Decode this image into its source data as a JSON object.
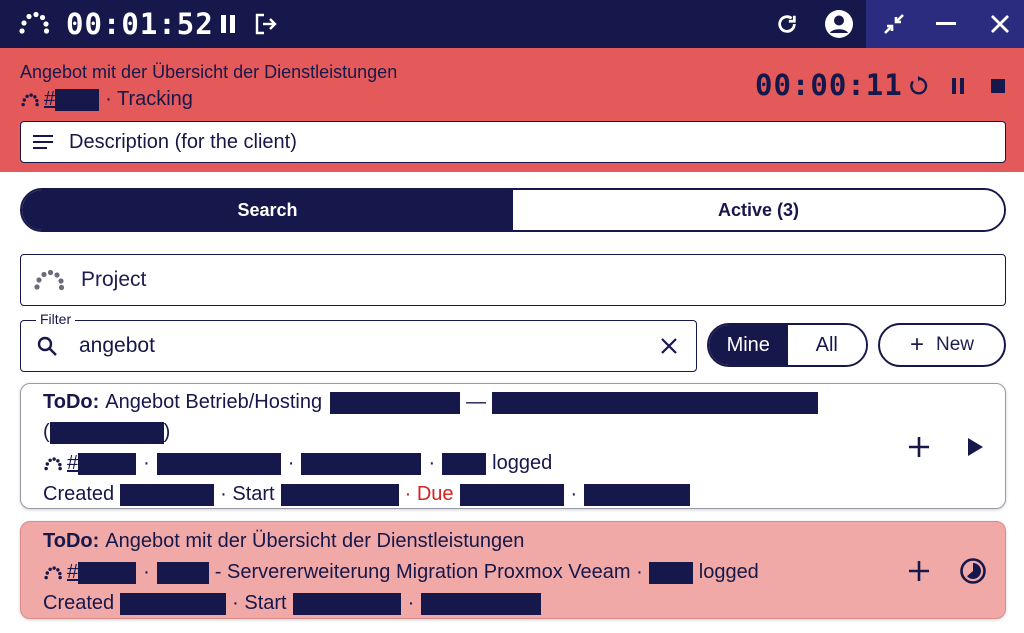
{
  "titlebar": {
    "timer": "00:01:52",
    "icons": [
      "logo-icon",
      "pause-icon",
      "logout-icon",
      "refresh-icon",
      "user-icon",
      "collapse-icon",
      "minimize-icon",
      "close-icon"
    ]
  },
  "tracking": {
    "title": "Angebot mit der Übersicht der Dienstleistungen",
    "hash": "#",
    "subtitle": "· Tracking",
    "timer": "00:00:11",
    "description_placeholder": "Description (for the client)"
  },
  "tabs": [
    {
      "label": "Search",
      "active": true
    },
    {
      "label": "Active (3)",
      "active": false
    }
  ],
  "project": {
    "placeholder": "Project"
  },
  "filter": {
    "label": "Filter",
    "value": "angebot",
    "clear_icon": "close-icon"
  },
  "scope_toggle": {
    "options": [
      "Mine",
      "All"
    ],
    "selected": "Mine"
  },
  "new_button": {
    "label": "New"
  },
  "results": [
    {
      "type": "ToDo:",
      "title": "Angebot Betrieb/Hosting",
      "dash": "—",
      "paren_open": "(",
      "paren_close": ")",
      "hash": "#",
      "logged": "logged",
      "created": "Created",
      "start": "· Start",
      "due": "· Due",
      "dot": "·",
      "actions": [
        "add-icon",
        "play-icon"
      ]
    },
    {
      "type": "ToDo:",
      "title": "Angebot mit der Übersicht der Dienstleistungen",
      "hash": "#",
      "project_text": "- Servererweiterung Migration Proxmox Veeam ·",
      "logged": "logged",
      "created": "Created",
      "start": "· Start",
      "dot": "·",
      "actions": [
        "add-icon",
        "running-timer-icon"
      ]
    }
  ],
  "colors": {
    "navy": "#16174a",
    "tracking_red": "#e45a5a",
    "active_card": "#f0a9a7",
    "due_red": "#d2231f"
  }
}
